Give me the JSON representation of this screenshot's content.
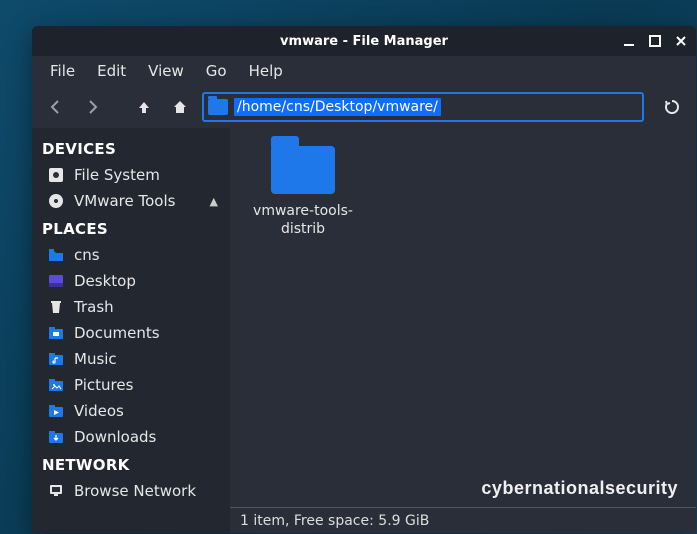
{
  "window": {
    "title": "vmware - File Manager"
  },
  "menu": {
    "file": "File",
    "edit": "Edit",
    "view": "View",
    "go": "Go",
    "help": "Help"
  },
  "path": "/home/cns/Desktop/vmware/",
  "sidebar": {
    "devices_header": "DEVICES",
    "places_header": "PLACES",
    "network_header": "NETWORK",
    "devices": [
      {
        "label": "File System"
      },
      {
        "label": "VMware Tools",
        "ejectable": true
      }
    ],
    "places": [
      {
        "label": "cns"
      },
      {
        "label": "Desktop"
      },
      {
        "label": "Trash"
      },
      {
        "label": "Documents"
      },
      {
        "label": "Music"
      },
      {
        "label": "Pictures"
      },
      {
        "label": "Videos"
      },
      {
        "label": "Downloads"
      }
    ],
    "network": [
      {
        "label": "Browse Network"
      }
    ]
  },
  "content": {
    "items": [
      {
        "label": "vmware-tools-distrib"
      }
    ]
  },
  "watermark": "cybernationalsecurity",
  "statusbar": "1 item, Free space: 5.9 GiB"
}
